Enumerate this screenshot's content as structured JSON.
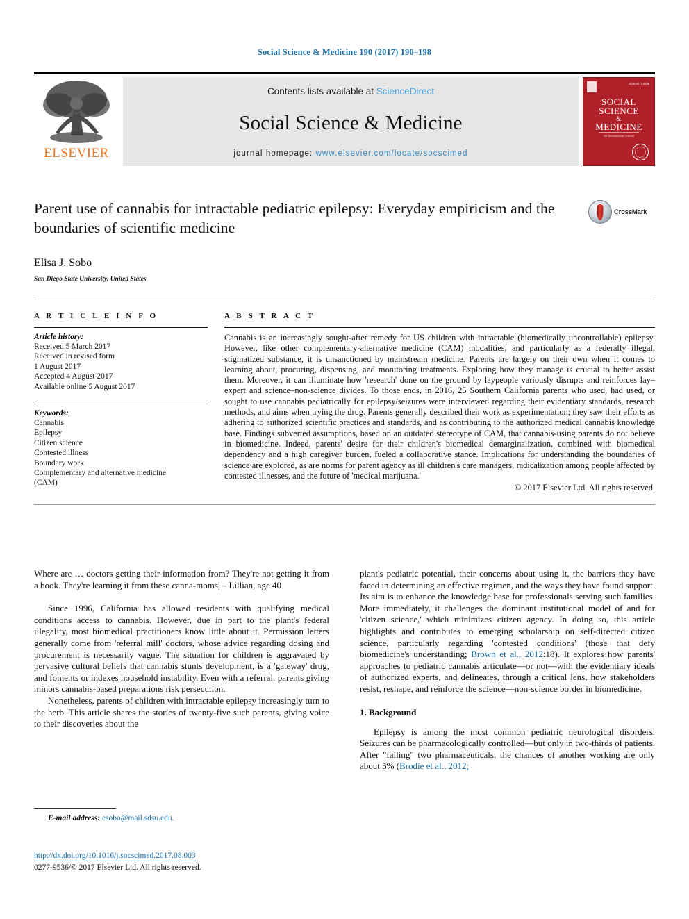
{
  "running_head": "Social Science & Medicine 190 (2017) 190–198",
  "masthead": {
    "publisher": "ELSEVIER",
    "contents_prefix": "Contents lists available at ",
    "contents_link": "ScienceDirect",
    "journal_title": "Social Science & Medicine",
    "homepage_prefix": "journal homepage: ",
    "homepage_url": "www.elsevier.com/locate/socscimed",
    "cover": {
      "line1": "SOCIAL",
      "line2": "SCIENCE",
      "amp": "&",
      "line3": "MEDICINE",
      "issn": "ISSN 0277-9536",
      "subtitle": "An International Journal"
    }
  },
  "article": {
    "title": "Parent use of cannabis for intractable pediatric epilepsy: Everyday empiricism and the boundaries of scientific medicine",
    "author": "Elisa J. Sobo",
    "affiliation": "San Diego State University, United States",
    "crossmark_label": "CrossMark"
  },
  "article_info": {
    "heading": "A R T I C L E  I N F O",
    "history_label": "Article history:",
    "history": [
      "Received 5 March 2017",
      "Received in revised form",
      "1 August 2017",
      "Accepted 4 August 2017",
      "Available online 5 August 2017"
    ],
    "keywords_label": "Keywords:",
    "keywords": [
      "Cannabis",
      "Epilepsy",
      "Citizen science",
      "Contested illness",
      "Boundary work",
      "Complementary and alternative medicine",
      "(CAM)"
    ]
  },
  "abstract": {
    "heading": "A B S T R A C T",
    "text": "Cannabis is an increasingly sought-after remedy for US children with intractable (biomedically uncontrollable) epilepsy. However, like other complementary-alternative medicine (CAM) modalities, and particularly as a federally illegal, stigmatized substance, it is unsanctioned by mainstream medicine. Parents are largely on their own when it comes to learning about, procuring, dispensing, and monitoring treatments. Exploring how they manage is crucial to better assist them. Moreover, it can illuminate how 'research' done on the ground by laypeople variously disrupts and reinforces lay–expert and science–non-science divides. To those ends, in 2016, 25 Southern California parents who used, had used, or sought to use cannabis pediatrically for epilepsy/seizures were interviewed regarding their evidentiary standards, research methods, and aims when trying the drug. Parents generally described their work as experimentation; they saw their efforts as adhering to authorized scientific practices and standards, and as contributing to the authorized medical cannabis knowledge base. Findings subverted assumptions, based on an outdated stereotype of CAM, that cannabis-using parents do not believe in biomedicine. Indeed, parents' desire for their children's biomedical demarginalization, combined with biomedical dependency and a high caregiver burden, fueled a collaborative stance. Implications for understanding the boundaries of science are explored, as are norms for parent agency as ill children's care managers, radicalization among people affected by contested illnesses, and the future of 'medical marijuana.'",
    "copyright": "© 2017 Elsevier Ltd. All rights reserved."
  },
  "body": {
    "epigraph": "Where are … doctors getting their information from? They're not getting it from a book. They're learning it from these canna-moms| – Lillian, age 40",
    "left_paragraphs": [
      "Since 1996, California has allowed residents with qualifying medical conditions access to cannabis. However, due in part to the plant's federal illegality, most biomedical practitioners know little about it. Permission letters generally come from 'referral mill' doctors, whose advice regarding dosing and procurement is necessarily vague. The situation for children is aggravated by pervasive cultural beliefs that cannabis stunts development, is a 'gateway' drug, and foments or indexes household instability. Even with a referral, parents giving minors cannabis-based preparations risk persecution.",
      "Nonetheless, parents of children with intractable epilepsy increasingly turn to the herb. This article shares the stories of twenty-five such parents, giving voice to their discoveries about the"
    ],
    "right_paragraph_1_a": "plant's pediatric potential, their concerns about using it, the barriers they have faced in determining an effective regimen, and the ways they have found support. Its aim is to enhance the knowledge base for professionals serving such families. More immediately, it challenges the dominant institutional model of and for 'citizen science,' which minimizes citizen agency. In doing so, this article highlights and contributes to emerging scholarship on self-directed citizen science, particularly regarding 'contested conditions' (those that defy biomedicine's understanding; ",
    "right_citation_1": "Brown et al., 2012",
    "right_paragraph_1_b": ":18). It explores how parents' approaches to pediatric cannabis articulate—or not—with the evidentiary ideals of authorized experts, and delineates, through a critical lens, how stakeholders resist, reshape, and reinforce the science—non-science border in biomedicine.",
    "section_title": "1. Background",
    "right_paragraph_2_a": "Epilepsy is among the most common pediatric neurological disorders. Seizures can be pharmacologically controlled—but only in two-thirds of patients. After \"failing\" two pharmaceuticals, the chances of another working are only about 5% (",
    "right_citation_2": "Brodie et al., 2012;"
  },
  "footnote": {
    "label": "E-mail address:",
    "email": "esobo@mail.sdsu.edu."
  },
  "footer": {
    "doi": "http://dx.doi.org/10.1016/j.socscimed.2017.08.003",
    "copyright": "0277-9536/© 2017 Elsevier Ltd. All rights reserved."
  },
  "colors": {
    "link": "#1a6ea8",
    "journal_red": "#b02028",
    "elsevier_orange": "#ee7622",
    "band_gray": "#e6e6e6"
  }
}
